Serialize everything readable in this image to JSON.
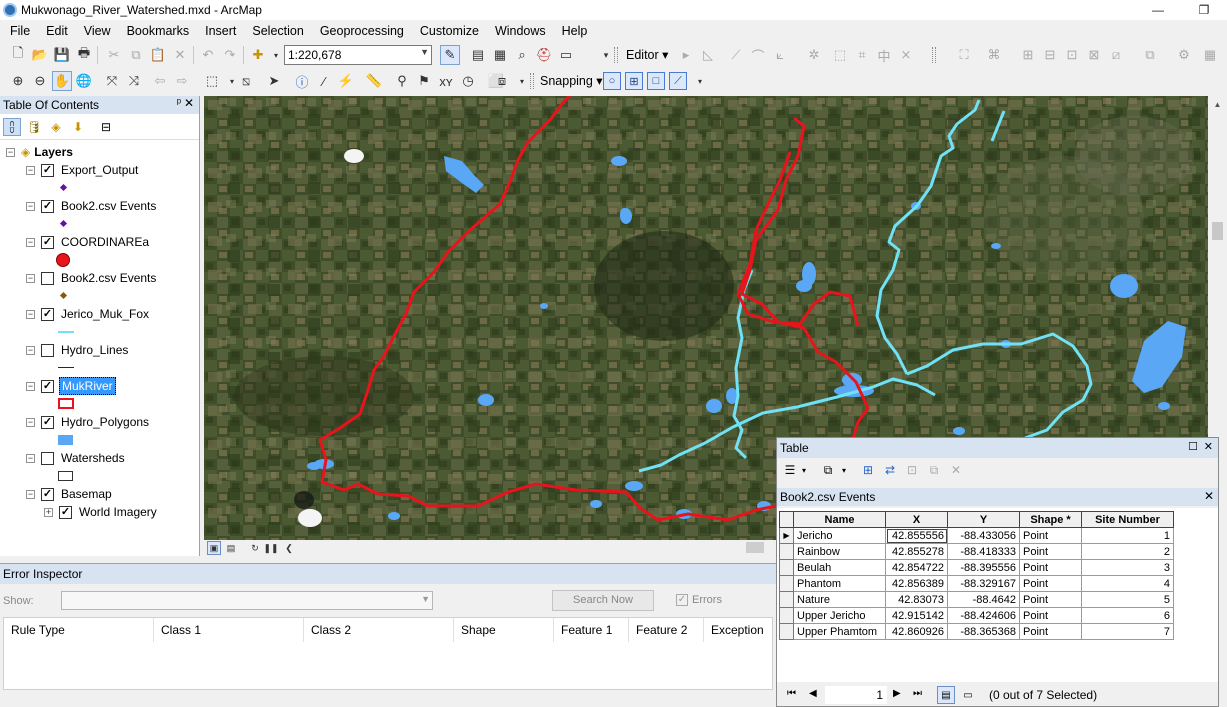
{
  "window": {
    "title": "Mukwonago_River_Watershed.mxd - ArcMap",
    "minimize": "—",
    "maximize": "❐",
    "close": "✕"
  },
  "menu": [
    "File",
    "Edit",
    "View",
    "Bookmarks",
    "Insert",
    "Selection",
    "Geoprocessing",
    "Customize",
    "Windows",
    "Help"
  ],
  "toolbar": {
    "scale_value": "1:220,678",
    "editor_label": "Editor ▾",
    "snapping_label": "Snapping ▾"
  },
  "toc": {
    "title": "Table Of Contents",
    "pin": "ᅟ📌",
    "close": "✕",
    "root_label": "Layers",
    "layers": [
      {
        "name": "Export_Output",
        "checked": true,
        "symbol": "purple-point"
      },
      {
        "name": "Book2.csv Events",
        "checked": true,
        "symbol": "purple-point"
      },
      {
        "name": "COORDINAREa",
        "checked": true,
        "symbol": "red-circle"
      },
      {
        "name": "Book2.csv Events",
        "checked": false,
        "symbol": "brown-point"
      },
      {
        "name": "Jerico_Muk_Fox",
        "checked": true,
        "symbol": "cyan-line"
      },
      {
        "name": "Hydro_Lines",
        "checked": false,
        "symbol": "navy-line"
      },
      {
        "name": "MukRiver",
        "checked": true,
        "symbol": "red-hollow-rect",
        "selected": true
      },
      {
        "name": "Hydro_Polygons",
        "checked": true,
        "symbol": "blue-fill-rect"
      },
      {
        "name": "Watersheds",
        "checked": false,
        "symbol": "white-rect"
      },
      {
        "name": "Basemap",
        "checked": true,
        "symbol": "none"
      }
    ],
    "sublayer": {
      "name": "World Imagery",
      "checked": true
    }
  },
  "error_inspector": {
    "title": "Error Inspector",
    "show_label": "Show:",
    "show_value": "",
    "search_button": "Search Now",
    "errors_label": "Errors",
    "errors_checked": true,
    "columns": [
      "Rule Type",
      "Class 1",
      "Class 2",
      "Shape",
      "Feature 1",
      "Feature 2",
      "Exception"
    ]
  },
  "table": {
    "title": "Table",
    "tab_title": "Book2.csv Events",
    "columns": [
      "Name",
      "X",
      "Y",
      "Shape *",
      "Site Number"
    ],
    "rows": [
      [
        "Jericho",
        "42.855556",
        "-88.433056",
        "Point",
        "1"
      ],
      [
        "Rainbow",
        "42.855278",
        "-88.418333",
        "Point",
        "2"
      ],
      [
        "Beulah",
        "42.854722",
        "-88.395556",
        "Point",
        "3"
      ],
      [
        "Phantom",
        "42.856389",
        "-88.329167",
        "Point",
        "4"
      ],
      [
        "Nature",
        "42.83073",
        "-88.4642",
        "Point",
        "5"
      ],
      [
        "Upper Jericho",
        "42.915142",
        "-88.424606",
        "Point",
        "6"
      ],
      [
        "Upper Phamtom",
        "42.860926",
        "-88.365368",
        "Point",
        "7"
      ]
    ],
    "record_number": "1",
    "status": "(0 out of 7 Selected)"
  },
  "colors": {
    "watershed_boundary": "#e8141c",
    "river": "#6fe2f7",
    "lakes": "#5aa8f5",
    "selection": "#3399ff",
    "panel_header": "#d8e3f2"
  }
}
